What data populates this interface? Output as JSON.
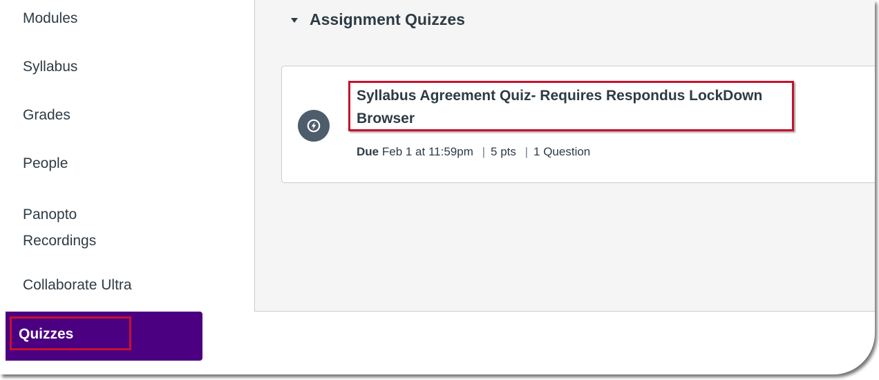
{
  "sidebar": {
    "items": [
      {
        "label": "Modules"
      },
      {
        "label": "Syllabus"
      },
      {
        "label": "Grades"
      },
      {
        "label": "People"
      },
      {
        "label": "Panopto\nRecordings"
      },
      {
        "label": "Collaborate Ultra"
      }
    ],
    "active_item": {
      "label": "Quizzes"
    }
  },
  "main": {
    "group_title": "Assignment Quizzes",
    "quiz": {
      "title": "Syllabus Agreement Quiz- Requires Respondus LockDown Browser",
      "due_label": "Due",
      "due_date": "Feb 1 at 11:59pm",
      "separator": "|",
      "points": "5 pts",
      "questions": "1 Question",
      "icon": "quiz-rocket-icon"
    }
  },
  "colors": {
    "active_nav_bg": "#4b0082",
    "highlight_border": "#c8102e",
    "text": "#2d3b45",
    "panel_bg": "#f5f5f5",
    "icon_bg": "#4e5d6c"
  }
}
